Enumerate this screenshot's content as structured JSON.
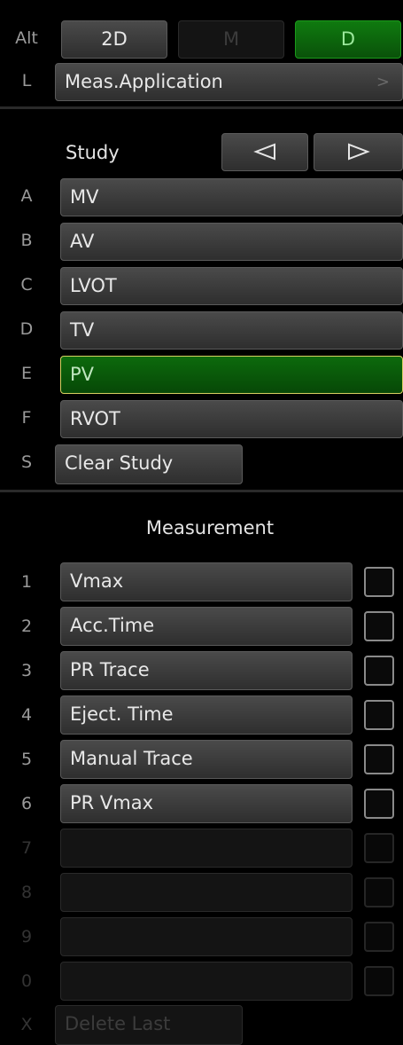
{
  "top": {
    "alt_key": "Alt",
    "modes": [
      {
        "label": "2D",
        "state": "normal"
      },
      {
        "label": "M",
        "state": "disabled"
      },
      {
        "label": "D",
        "state": "active"
      }
    ],
    "l_key": "L",
    "meas_application": "Meas.Application",
    "meas_application_chevron": ">"
  },
  "study": {
    "title": "Study",
    "items": [
      {
        "key": "A",
        "label": "MV"
      },
      {
        "key": "B",
        "label": "AV"
      },
      {
        "key": "C",
        "label": "LVOT"
      },
      {
        "key": "D",
        "label": "TV"
      },
      {
        "key": "E",
        "label": "PV",
        "selected": true
      },
      {
        "key": "F",
        "label": "RVOT"
      }
    ],
    "clear_key": "S",
    "clear_label": "Clear Study"
  },
  "measurement": {
    "title": "Measurement",
    "items": [
      {
        "key": "1",
        "label": "Vmax"
      },
      {
        "key": "2",
        "label": "Acc.Time"
      },
      {
        "key": "3",
        "label": "PR Trace"
      },
      {
        "key": "4",
        "label": "Eject. Time"
      },
      {
        "key": "5",
        "label": "Manual Trace"
      },
      {
        "key": "6",
        "label": "PR Vmax"
      },
      {
        "key": "7",
        "label": ""
      },
      {
        "key": "8",
        "label": ""
      },
      {
        "key": "9",
        "label": ""
      },
      {
        "key": "0",
        "label": ""
      }
    ],
    "delete_key": "X",
    "delete_label": "Delete Last"
  },
  "colors": {
    "active_green": "#0f7a0f",
    "selected_border": "#d8d060"
  }
}
